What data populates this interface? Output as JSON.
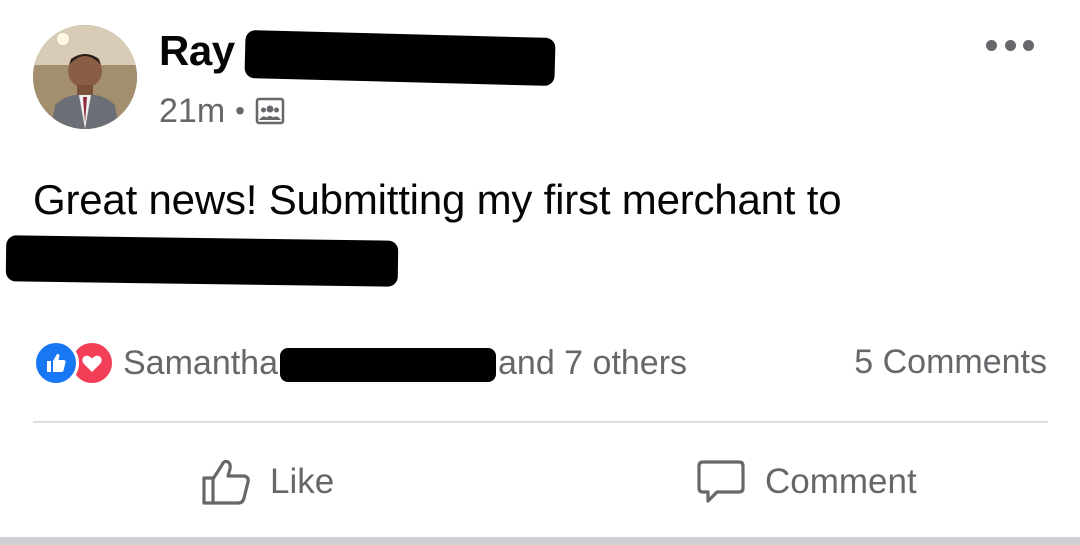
{
  "post": {
    "author": {
      "name": "Ray",
      "name_redacted": true
    },
    "timestamp": "21m",
    "meta_separator": "•",
    "audience_icon": "group-audience-icon",
    "more_icon": "more-options-icon",
    "text_line1": "Great news! Submitting my first merchant to",
    "text_line2_redacted": true
  },
  "reactions": {
    "types": [
      "like",
      "love"
    ],
    "reactor_name": "Samantha",
    "reactor_suffix": "and 7 others",
    "comments_count": "5 Comments"
  },
  "actions": {
    "like_label": "Like",
    "comment_label": "Comment"
  },
  "colors": {
    "secondary_text": "#65676b",
    "like_blue": "#1877f2",
    "love_red": "#f33e58",
    "redaction": "#000000"
  }
}
